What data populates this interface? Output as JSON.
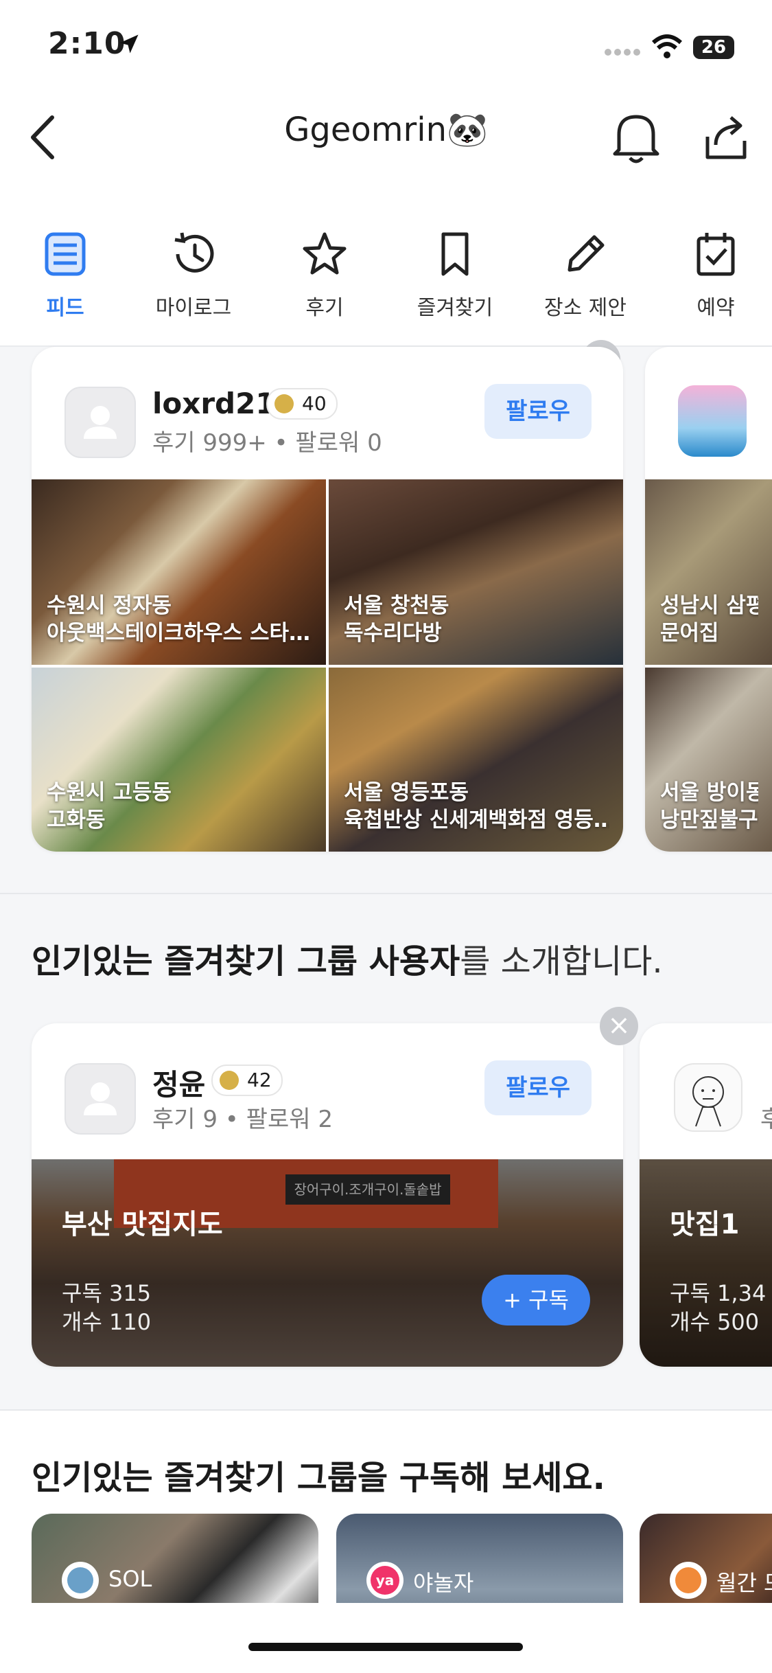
{
  "status_bar": {
    "time": "2:10",
    "battery": "26"
  },
  "header": {
    "title": "Ggeomrin🐼"
  },
  "tabs": [
    {
      "label": "피드",
      "icon": "feed-icon",
      "active": true
    },
    {
      "label": "마이로그",
      "icon": "history-icon",
      "active": false
    },
    {
      "label": "후기",
      "icon": "star-icon",
      "active": false
    },
    {
      "label": "즐겨찾기",
      "icon": "bookmark-icon",
      "active": false
    },
    {
      "label": "장소 제안",
      "icon": "pencil-icon",
      "active": false
    },
    {
      "label": "예약",
      "icon": "calendar-check-icon",
      "active": false
    }
  ],
  "recommended_users": {
    "primary": {
      "name": "loxrd21",
      "level": "40",
      "stats": "후기 999+ • 팔로워 0",
      "follow_label": "팔로우",
      "photos": [
        {
          "location": "수원시 정자동",
          "place": "아웃백스테이크하우스 스타…"
        },
        {
          "location": "서울 창천동",
          "place": "독수리다방"
        },
        {
          "location": "수원시 고등동",
          "place": "고화동"
        },
        {
          "location": "서울 영등포동",
          "place": "육첩반상 신세계백화점 영등…"
        }
      ]
    },
    "secondary": {
      "photos": [
        {
          "location": "성남시 삼평동",
          "place": "문어집"
        },
        {
          "location": "서울 방이동",
          "place": "낭만짚불구이"
        }
      ]
    }
  },
  "popular_group_users": {
    "title_bold": "인기있는 즐겨찾기 그룹 사용자",
    "title_light": "를 소개합니다.",
    "primary": {
      "name": "정윤",
      "level": "42",
      "stats": "후기 9 • 팔로워 2",
      "follow_label": "팔로우",
      "group": {
        "name": "부산 맛집지도",
        "subscribers": "구독 315",
        "count": "개수 110",
        "subscribe_label": "+ 구독",
        "sign_text": "장어구이.조개구이.돌솥밥"
      }
    },
    "secondary": {
      "stats_partial": "후",
      "group": {
        "name": "맛집1",
        "subscribers": "구독 1,34",
        "count": "개수 500"
      }
    }
  },
  "popular_groups": {
    "title": "인기있는 즐겨찾기 그룹을 구독해 보세요.",
    "items": [
      {
        "label": "SOL"
      },
      {
        "label": "야놀자",
        "badge": "ya"
      },
      {
        "label": "월간 모"
      }
    ]
  },
  "colors": {
    "accent": "#2f7cf0",
    "follow_bg": "#e3edfc",
    "level_badge": "#d6b048"
  }
}
